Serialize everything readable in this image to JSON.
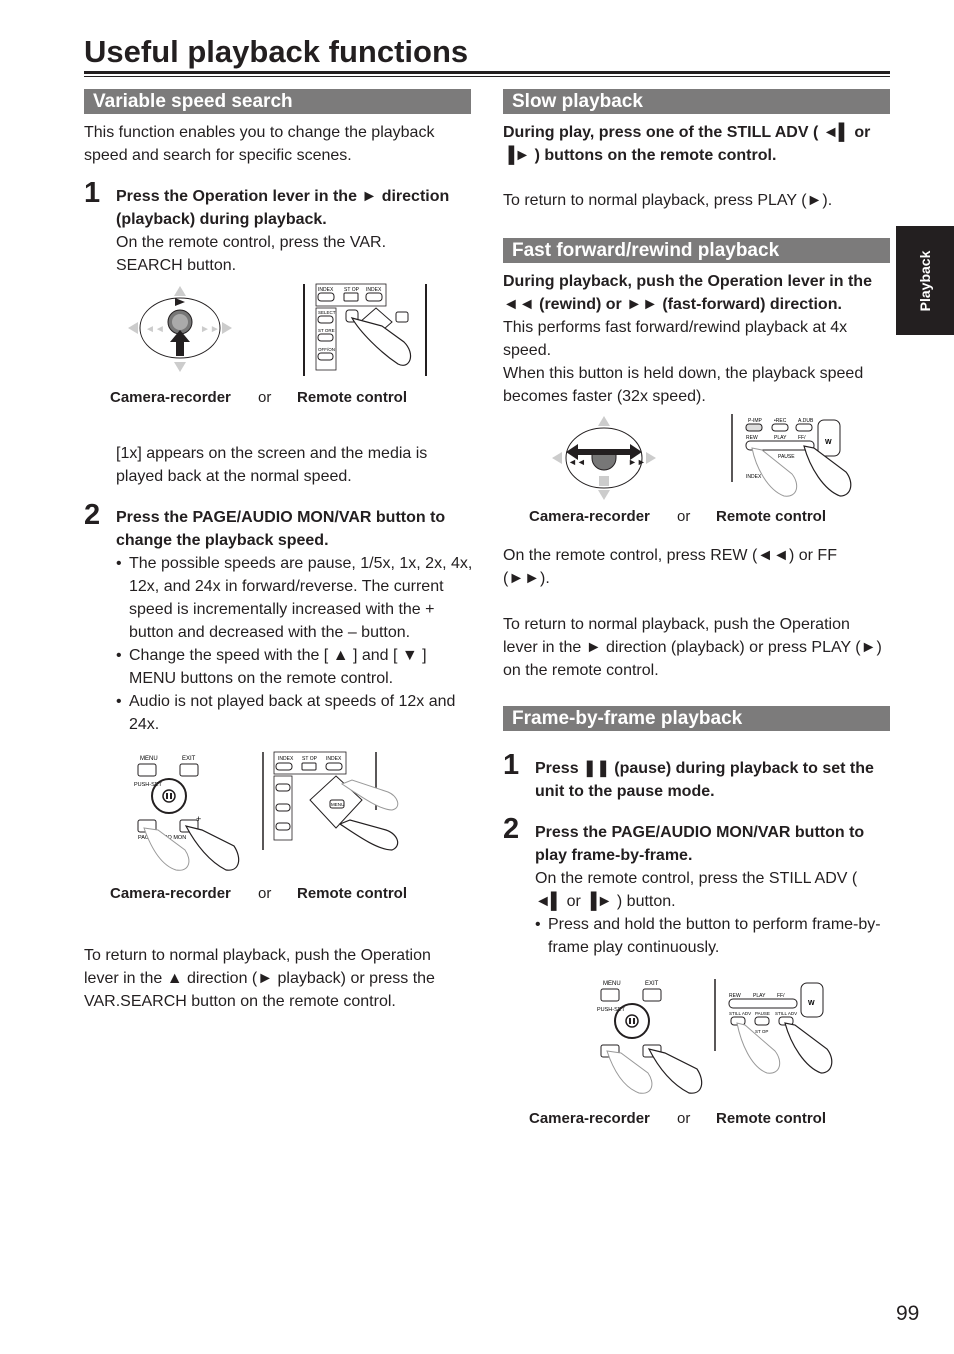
{
  "page": {
    "title": "Useful playback functions",
    "side_tab": "Playback",
    "page_number": "99"
  },
  "variable_speed": {
    "heading": "Variable speed search",
    "intro": "This function enables you to change the playback speed and search for specific scenes.",
    "step1": {
      "number": "1",
      "bold_line1": "Press the Operation lever in the ► direction",
      "bold_line2": "(playback) during playback.",
      "normal": "On the remote control, press the VAR. SEARCH button."
    },
    "figure1": {
      "camera_label": "Camera-recorder",
      "or_label": "or",
      "remote_label": "Remote control"
    },
    "note": "[1x] appears on the screen and the media is played back at the normal speed.",
    "step2": {
      "number": "2",
      "bold": "Press the PAGE/AUDIO MON/VAR button to change the playback speed.",
      "bullets": [
        "The possible speeds are pause, 1/5x, 1x, 2x, 4x, 12x, and 24x in forward/reverse. The current speed is incrementally increased with the + button and decreased with the – button.",
        "Change the speed with the [ ▲ ] and [ ▼ ] MENU buttons on the remote control.",
        "Audio is not played back at speeds of 12x and 24x."
      ]
    },
    "figure2": {
      "camera_label": "Camera-recorder",
      "or_label": "or",
      "remote_label": "Remote control"
    },
    "return_text": "To return to normal playback, push the Operation lever in the ▲ direction (► playback) or press the VAR.SEARCH button on the remote control."
  },
  "slow": {
    "heading": "Slow playback",
    "bold": "During play, press one of the STILL ADV ( ◄▌ or ▐► ) buttons on the remote control.",
    "return_text": "To return to normal playback, press PLAY (►)."
  },
  "fast": {
    "heading": "Fast forward/rewind playback",
    "bold": "During playback, push the Operation lever in the ◄◄ (rewind) or ►► (fast-forward) direction.",
    "p1": "This performs fast forward/rewind playback at 4x speed.",
    "p2": "When this button is held down, the playback speed becomes faster (32x speed).",
    "figure": {
      "camera_label": "Camera-recorder",
      "or_label": "or",
      "remote_label": "Remote control"
    },
    "remote_text": "On the remote control, press REW (◄◄) or FF (►►).",
    "return_text": "To return to normal playback, push the Operation lever in the ► direction (playback) or press PLAY (►) on the remote control."
  },
  "frame": {
    "heading": "Frame-by-frame playback",
    "step1": {
      "number": "1",
      "bold": "Press ❚❚ (pause) during playback to set the unit to the pause mode."
    },
    "step2": {
      "number": "2",
      "bold": "Press the PAGE/AUDIO MON/VAR button to play frame-by-frame.",
      "normal": "On the remote control, press the STILL ADV ( ◄▌ or ▐► ) button.",
      "bullet": "Press and hold the button to perform frame-by-frame play continuously."
    },
    "figure": {
      "camera_label": "Camera-recorder",
      "or_label": "or",
      "remote_label": "Remote control"
    }
  },
  "illustrations": {
    "remote_labels_top": [
      "INDEX",
      "ST OP",
      "INDEX"
    ],
    "remote_labels_side": [
      "SELECT",
      "ST ORE",
      "OFF/ON"
    ],
    "remote_labels_ff": [
      "P-IMP",
      "•REC",
      "A.DUB",
      "REW",
      "PLAY",
      "FF/",
      "PAUSE",
      "INDEX"
    ],
    "remote_labels_frame": [
      "REW",
      "PLAY",
      "FF/",
      "STILL ADV",
      "PAUSE",
      "STILL ADV",
      "ST OP"
    ],
    "camera_labels": [
      "MENU",
      "EXIT",
      "PUSH-SET",
      "PAGE/AUDIO MON"
    ],
    "w_label": "W",
    "menu_label": "MENU"
  }
}
